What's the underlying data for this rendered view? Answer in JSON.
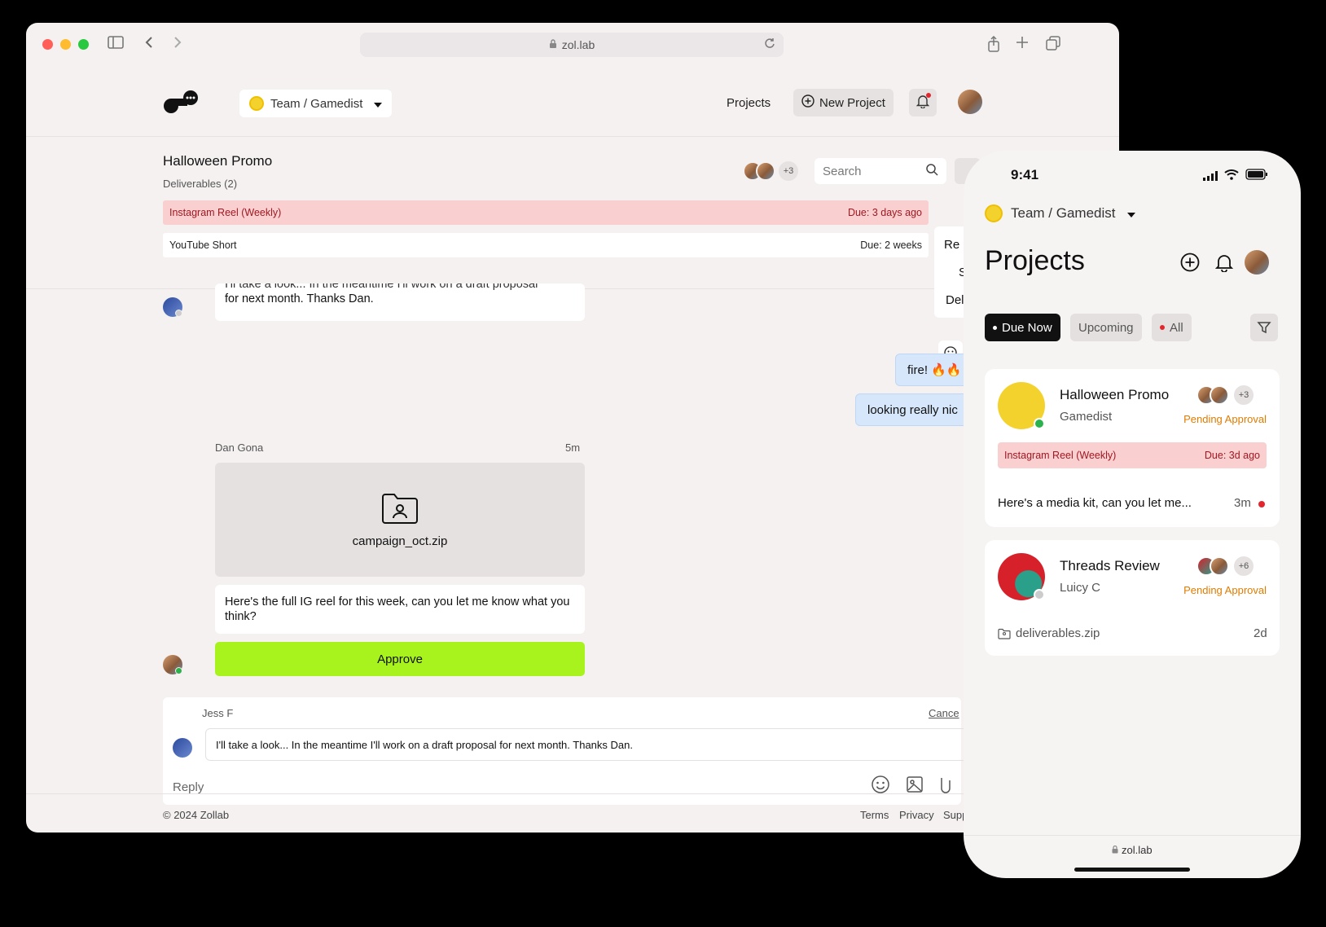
{
  "browser": {
    "url": "zol.lab",
    "team_selector": "Team / Gamedist",
    "nav": {
      "projects": "Projects",
      "new_project": "New Project"
    },
    "project": {
      "title": "Halloween Promo",
      "subtitle": "Deliverables (2)",
      "extra_members": "+3"
    },
    "search": {
      "placeholder": "Search"
    },
    "deliverables": [
      {
        "name": "Instagram Reel (Weekly)",
        "due": "Due: 3 days ago"
      },
      {
        "name": "YouTube Short",
        "due": "Due: 2 weeks"
      }
    ],
    "context_menu": [
      "Re",
      "S",
      "Del"
    ],
    "messages": {
      "cut_off_top": "I'll take a look... In the meantime I'll work on a draft proposal",
      "prev_tail": "for next month. Thanks Dan.",
      "fire": "fire! 🔥🔥🔥",
      "looking": "looking really nic",
      "author": "Dan Gona",
      "time": "5m",
      "file_name": "campaign_oct.zip",
      "body": "Here's the full IG reel for this week, can you let me know what you think?",
      "approve_label": "Approve"
    },
    "reply": {
      "quoted_author": "Jess F",
      "cancel": "Cance",
      "quoted_text": "I'll take a look... In the meantime I'll work on a draft proposal for next month. Thanks Dan.",
      "placeholder": "Reply"
    },
    "footer": {
      "copyright": "© 2024 Zollab",
      "links": [
        "Terms",
        "Privacy",
        "Supp"
      ]
    }
  },
  "phone": {
    "time": "9:41",
    "team_selector": "Team / Gamedist",
    "title": "Projects",
    "filters": [
      "Due Now",
      "Upcoming",
      "All"
    ],
    "cards": [
      {
        "name": "Halloween Promo",
        "client": "Gamedist",
        "status": "Pending Approval",
        "extra": "+3",
        "deliverable": "Instagram Reel (Weekly)",
        "due": "Due: 3d ago",
        "last_message": "Here's a media kit, can you let me...",
        "last_time": "3m"
      },
      {
        "name": "Threads Review",
        "client": "Luicy C",
        "status": "Pending Approval",
        "extra": "+6",
        "last_file": "deliverables.zip",
        "last_time": "2d"
      }
    ],
    "url": "zol.lab"
  },
  "colors": {
    "accent_green": "#a8f31e",
    "danger_bg": "#f9cfd0",
    "danger_text": "#a01822",
    "pending": "#e07b00",
    "bubble_blue": "#d6e6fb"
  }
}
